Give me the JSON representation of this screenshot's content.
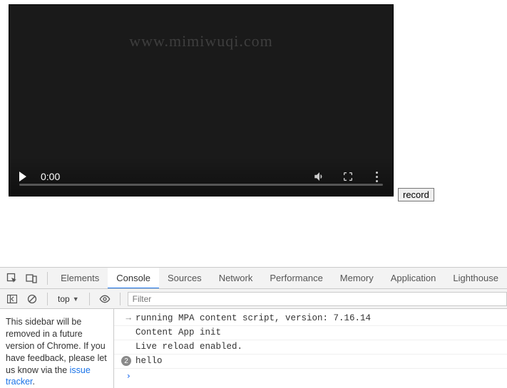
{
  "video": {
    "watermark": "www.mimiwuqi.com",
    "time": "0:00"
  },
  "record_button": "record",
  "devtools": {
    "tabs": [
      "Elements",
      "Console",
      "Sources",
      "Network",
      "Performance",
      "Memory",
      "Application",
      "Lighthouse"
    ],
    "active_tab": "Console",
    "context": "top",
    "filter_placeholder": "Filter",
    "sidebar_message": {
      "text_prefix": "This sidebar will be removed in a future version of Chrome. If you have feedback, please let us know via the ",
      "link_text": "issue tracker"
    },
    "logs": [
      {
        "prefix": "→",
        "text": "running MPA content script, version: 7.16.14"
      },
      {
        "prefix": "",
        "text": "Content App init"
      },
      {
        "prefix": "",
        "text": "Live reload enabled."
      },
      {
        "badge": "2",
        "text": "hello"
      }
    ]
  }
}
